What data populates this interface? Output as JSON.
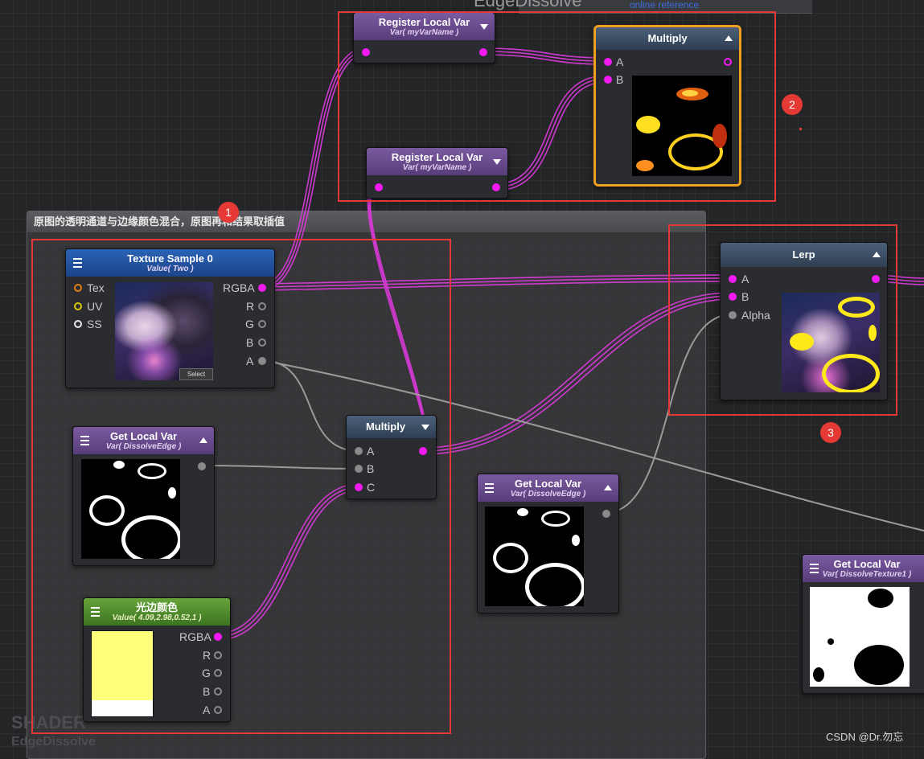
{
  "editor": {
    "title_partial": "EdgeDissolve",
    "online_reference": "online reference",
    "watermark_shader": "SHADER",
    "watermark_name": "EdgeDissolve",
    "credit": "CSDN @Dr.勿忘"
  },
  "group": {
    "title": "原图的透明通道与边缘颜色混合，原图再和结果取插值"
  },
  "annotations": {
    "badge1": "1",
    "badge2": "2",
    "badge3": "3"
  },
  "nodes": {
    "register_top": {
      "title": "Register Local Var",
      "subtitle": "Var( myVarName )"
    },
    "register_bottom": {
      "title": "Register Local Var",
      "subtitle": "Var( myVarName )"
    },
    "multiply_top": {
      "title": "Multiply",
      "in_a": "A",
      "in_b": "B"
    },
    "texture_sample": {
      "title": "Texture Sample 0",
      "subtitle": "Value( Two )",
      "in_tex": "Tex",
      "in_uv": "UV",
      "in_ss": "SS",
      "out_rgba": "RGBA",
      "out_r": "R",
      "out_g": "G",
      "out_b": "B",
      "out_a": "A",
      "select_label": "Select"
    },
    "get_local_edge_left": {
      "title": "Get Local Var",
      "subtitle": "Var( DissolveEdge )"
    },
    "multiply_mid": {
      "title": "Multiply",
      "in_a": "A",
      "in_b": "B",
      "in_c": "C"
    },
    "edge_color": {
      "title": "光边颜色",
      "subtitle": "Value( 4.09,2.98,0.52,1 )",
      "out_rgba": "RGBA",
      "out_r": "R",
      "out_g": "G",
      "out_b": "B",
      "out_a": "A",
      "swatch_color": "#ffff7a"
    },
    "get_local_edge_mid": {
      "title": "Get Local Var",
      "subtitle": "Var( DissolveEdge )"
    },
    "lerp": {
      "title": "Lerp",
      "in_a": "A",
      "in_b": "B",
      "in_alpha": "Alpha"
    },
    "get_local_tex1": {
      "title": "Get Local Var",
      "subtitle": "Var( DissolveTexture1 )"
    }
  },
  "colors": {
    "wire_magenta": "#e03ce8",
    "wire_gray": "#9a9a9a",
    "annotation_red": "#e53935",
    "selection_orange": "#f0a020"
  }
}
